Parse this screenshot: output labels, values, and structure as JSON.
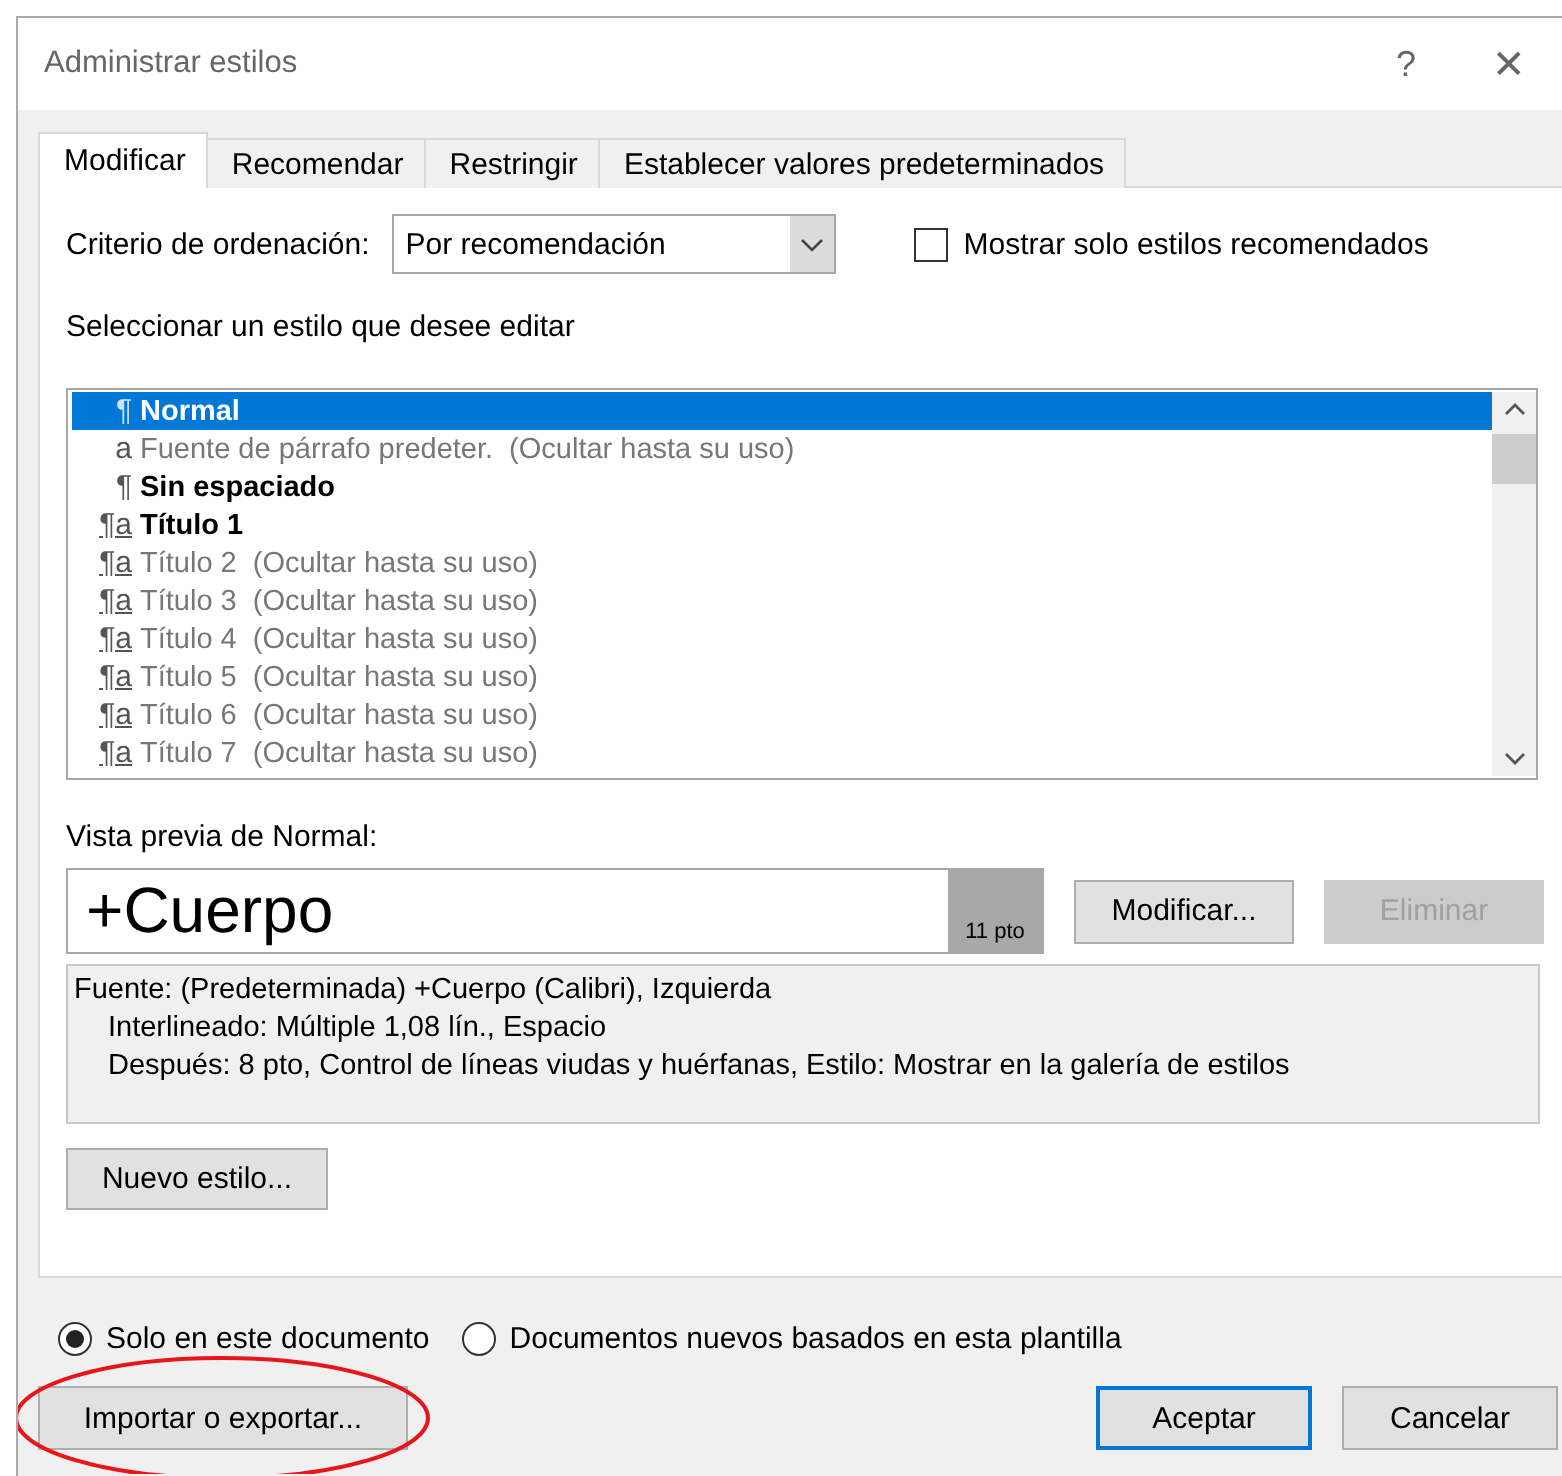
{
  "window": {
    "title": "Administrar estilos",
    "help": "?",
    "close": "✕"
  },
  "tabs": [
    {
      "label": "Modificar",
      "selected": true
    },
    {
      "label": "Recomendar",
      "selected": false
    },
    {
      "label": "Restringir",
      "selected": false
    },
    {
      "label": "Establecer valores predeterminados",
      "selected": false
    }
  ],
  "sort": {
    "label": "Criterio de ordenación:",
    "value": "Por recomendación"
  },
  "recommended_only": {
    "label": "Mostrar solo estilos recomendados",
    "checked": false
  },
  "list_label": "Seleccionar un estilo que desee editar",
  "styles": [
    {
      "kind": "paragraph",
      "icon": "¶",
      "name": "Normal",
      "hidden": false,
      "selected": true
    },
    {
      "kind": "character",
      "icon": "a",
      "name": "Fuente de párrafo predeter.",
      "note": "(Ocultar hasta su uso)",
      "hidden": true,
      "selected": false
    },
    {
      "kind": "paragraph",
      "icon": "¶",
      "name": "Sin espaciado",
      "hidden": false,
      "selected": false
    },
    {
      "kind": "linked",
      "icon": "¶a",
      "name": "Título 1",
      "hidden": false,
      "selected": false
    },
    {
      "kind": "linked",
      "icon": "¶a",
      "name": "Título 2",
      "note": "(Ocultar hasta su uso)",
      "hidden": true,
      "selected": false
    },
    {
      "kind": "linked",
      "icon": "¶a",
      "name": "Título 3",
      "note": "(Ocultar hasta su uso)",
      "hidden": true,
      "selected": false
    },
    {
      "kind": "linked",
      "icon": "¶a",
      "name": "Título 4",
      "note": "(Ocultar hasta su uso)",
      "hidden": true,
      "selected": false
    },
    {
      "kind": "linked",
      "icon": "¶a",
      "name": "Título 5",
      "note": "(Ocultar hasta su uso)",
      "hidden": true,
      "selected": false
    },
    {
      "kind": "linked",
      "icon": "¶a",
      "name": "Título 6",
      "note": "(Ocultar hasta su uso)",
      "hidden": true,
      "selected": false
    },
    {
      "kind": "linked",
      "icon": "¶a",
      "name": "Título 7",
      "note": "(Ocultar hasta su uso)",
      "hidden": true,
      "selected": false
    }
  ],
  "preview": {
    "label": "Vista previa de Normal:",
    "sample": "+Cuerpo",
    "size": "11 pto"
  },
  "modify_button": {
    "label": "Modificar...",
    "disabled": false
  },
  "delete_button": {
    "label": "Eliminar",
    "disabled": true
  },
  "description": [
    "Fuente: (Predeterminada) +Cuerpo (Calibri), Izquierda",
    "Interlineado:  Múltiple 1,08 lín., Espacio",
    "Después:  8 pto, Control de líneas viudas y huérfanas, Estilo: Mostrar en la galería de estilos"
  ],
  "new_style_button": {
    "label": "Nuevo estilo..."
  },
  "scope": [
    {
      "label": "Solo en este documento",
      "selected": true
    },
    {
      "label": "Documentos nuevos basados en esta plantilla",
      "selected": false
    }
  ],
  "import_button": {
    "label": "Importar o exportar...",
    "circled": true
  },
  "buttons": [
    {
      "label": "Aceptar",
      "default": true
    },
    {
      "label": "Cancelar",
      "default": false
    }
  ]
}
